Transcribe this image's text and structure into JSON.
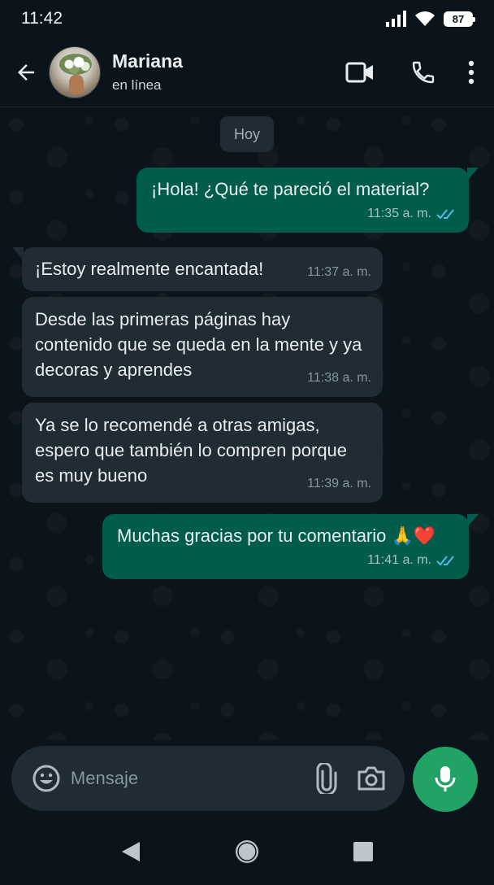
{
  "status_bar": {
    "time": "11:42",
    "battery": "87"
  },
  "header": {
    "contact_name": "Mariana",
    "contact_status": "en línea",
    "icons": [
      "back-arrow-icon",
      "video-call-icon",
      "phone-icon",
      "more-vert-icon"
    ]
  },
  "chat": {
    "date_label": "Hoy",
    "messages": [
      {
        "direction": "out",
        "text": "¡Hola! ¿Qué te pareció el material?",
        "time": "11:35 a. m.",
        "status": "read"
      },
      {
        "direction": "in",
        "text": "¡Estoy realmente encantada!",
        "time": "11:37 a. m."
      },
      {
        "direction": "in",
        "text": "Desde las primeras páginas hay contenido que se queda en la mente y ya decoras y aprendes",
        "time": "11:38 a. m."
      },
      {
        "direction": "in",
        "text": "Ya se lo recomendé a otras amigas, espero que también lo compren porque es muy bueno",
        "time": "11:39 a. m."
      },
      {
        "direction": "out",
        "text": "Muchas gracias por tu comentario 🙏❤️",
        "time": "11:41 a. m.",
        "status": "read"
      }
    ]
  },
  "composer": {
    "placeholder": "Mensaje"
  },
  "colors": {
    "background": "#0b141a",
    "outgoing_bubble": "#005c4b",
    "incoming_bubble": "#1f2c33",
    "accent": "#21a366",
    "read_ticks": "#53bdeb"
  }
}
